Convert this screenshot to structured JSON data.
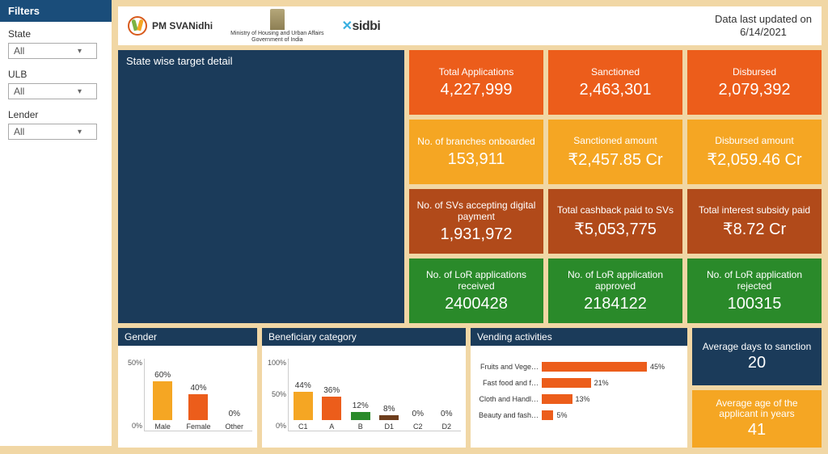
{
  "header": {
    "pm_label": "PM SVANidhi",
    "ministry_label": "Ministry of Housing and Urban Affairs\nGovernment of India",
    "sidbi_label": "sidbi",
    "updated_label": "Data last updated on",
    "updated_date": "6/14/2021"
  },
  "filters": {
    "title": "Filters",
    "state_label": "State",
    "state_value": "All",
    "ulb_label": "ULB",
    "ulb_value": "All",
    "lender_label": "Lender",
    "lender_value": "All"
  },
  "state_panel_title": "State wise target detail",
  "kpi": {
    "total_apps": {
      "label": "Total Applications",
      "value": "4,227,999"
    },
    "sanctioned": {
      "label": "Sanctioned",
      "value": "2,463,301"
    },
    "disbursed": {
      "label": "Disbursed",
      "value": "2,079,392"
    },
    "branches": {
      "label": "No. of branches onboarded",
      "value": "153,911"
    },
    "sanc_amt": {
      "label": "Sanctioned amount",
      "value": "₹2,457.85 Cr"
    },
    "disb_amt": {
      "label": "Disbursed amount",
      "value": "₹2,059.46 Cr"
    },
    "sv_digital": {
      "label": "No. of SVs accepting digital payment",
      "value": "1,931,972"
    },
    "cashback": {
      "label": "Total cashback paid to SVs",
      "value": "₹5,053,775"
    },
    "interest": {
      "label": "Total interest subsidy paid",
      "value": "₹8.72 Cr"
    },
    "lor_recv": {
      "label": "No. of LoR applications received",
      "value": "2400428"
    },
    "lor_appr": {
      "label": "No. of LoR application approved",
      "value": "2184122"
    },
    "lor_rej": {
      "label": "No. of LoR application rejected",
      "value": "100315"
    }
  },
  "charts": {
    "gender_title": "Gender",
    "benef_title": "Beneficiary category",
    "vending_title": "Vending activities"
  },
  "chart_data": [
    {
      "name": "gender",
      "type": "bar",
      "categories": [
        "Male",
        "Female",
        "Other"
      ],
      "values": [
        60,
        40,
        0
      ],
      "ylim": [
        0,
        100
      ],
      "yticks": [
        "50%",
        "0%"
      ],
      "colors": [
        "#f5a623",
        "#ec5d1b",
        "#888"
      ]
    },
    {
      "name": "beneficiary",
      "type": "bar",
      "categories": [
        "C1",
        "A",
        "B",
        "D1",
        "C2",
        "D2"
      ],
      "values": [
        44,
        36,
        12,
        8,
        0,
        0
      ],
      "ylim": [
        0,
        100
      ],
      "yticks": [
        "100%",
        "50%",
        "0%"
      ],
      "colors": [
        "#f5a623",
        "#ec5d1b",
        "#2a8a2a",
        "#6d3d1c",
        "#1b3b5a",
        "#888"
      ]
    },
    {
      "name": "vending",
      "type": "bar",
      "orientation": "horizontal",
      "categories": [
        "Fruits and Vege…",
        "Fast food and f…",
        "Cloth and Handl…",
        "Beauty and fash…"
      ],
      "values": [
        45,
        21,
        13,
        5
      ],
      "color": "#ec5d1b"
    }
  ],
  "right_kpis": {
    "avg_days": {
      "label": "Average days to sanction",
      "value": "20"
    },
    "avg_age": {
      "label": "Average age of the applicant in years",
      "value": "41"
    }
  }
}
